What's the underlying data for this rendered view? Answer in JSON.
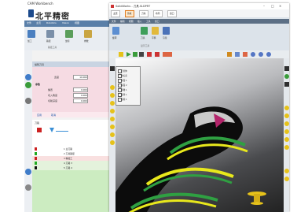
{
  "back_window": {
    "title": "CAM Workbench",
    "logo_text": "北平精密",
    "ribbon_tabs": [
      "文件",
      "主页",
      "Robotics",
      "Vision",
      "视图"
    ],
    "ribbon_buttons": [
      "加工",
      "路径",
      "坐标",
      "参数"
    ],
    "ribbon_group": "路径工具",
    "panel_title": "编辑刀具",
    "form": {
      "row1_label": "宽度",
      "row1_value": "10.000",
      "section_label": "参数",
      "row2_label": "偏置",
      "row2_value": "0.000",
      "row3_label": "切入角度",
      "row3_value": "0.000",
      "row4_label": "切削深度",
      "row4_value": "0.000",
      "apply_label": "应用",
      "cancel_label": "取消"
    },
    "tree_title": "刀路",
    "table_rows": [
      "1 主刀路",
      "2 刀具路径",
      "3 精加工",
      "4 刀路 3",
      "5 刀路 4"
    ],
    "colors": {
      "accent": "#5a7fa8",
      "form_bg": "#f6dbe3",
      "list_bg": "#ccecc1"
    }
  },
  "front_window": {
    "title": "SolidWorks - 刀具.SLDPRT",
    "tabs": [
      "主页",
      "仿真",
      "刀具",
      "布局",
      "窗口"
    ],
    "ribbon_subtabs": [
      "文件",
      "编辑",
      "视图",
      "插入",
      "工具",
      "窗口"
    ],
    "ribbon_buttons": [
      "旋转",
      "刀具",
      "平移",
      "渲染"
    ],
    "ribbon_group": "显示工具",
    "tree_items": [
      "刀具体",
      "坐标系",
      "平面 1",
      "平面 2",
      "草图 1",
      "旋转 1",
      "切除 1"
    ],
    "viewport_hint": "",
    "colors": {
      "stripe_yellow": "#e8e81c",
      "stripe_green": "#2fa042",
      "body_black": "#0c0c0c"
    }
  }
}
